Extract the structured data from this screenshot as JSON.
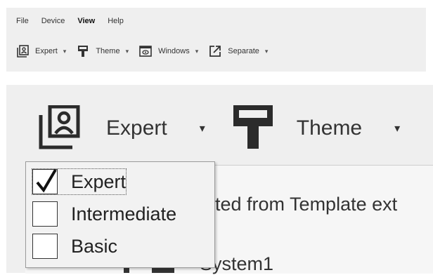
{
  "menu": {
    "items": [
      "File",
      "Device",
      "View",
      "Help"
    ],
    "active": "View"
  },
  "toolbar": {
    "expert_label": "Expert",
    "theme_label": "Theme",
    "windows_label": "Windows",
    "separate_label": "Separate",
    "caret": "▾"
  },
  "dropdown": {
    "options": [
      {
        "label": "Expert",
        "checked": true
      },
      {
        "label": "Intermediate",
        "checked": false
      },
      {
        "label": "Basic",
        "checked": false
      }
    ]
  },
  "background": {
    "line1": "ted from Template ext",
    "line2": "System1"
  }
}
